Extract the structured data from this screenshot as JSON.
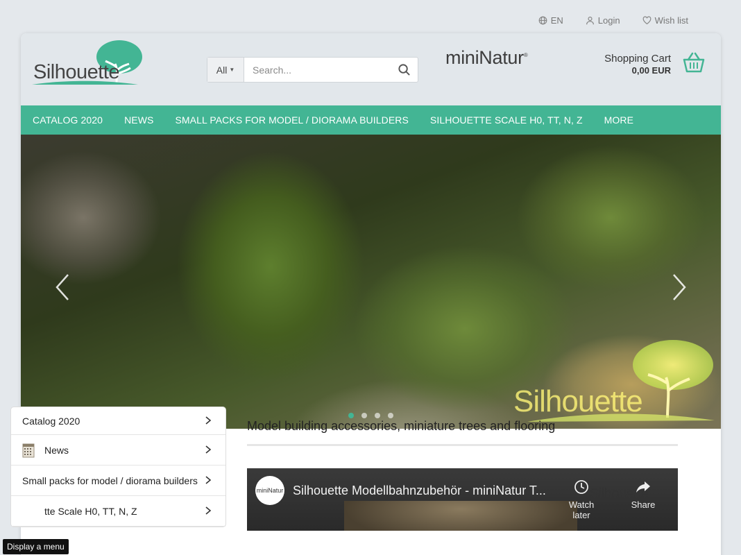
{
  "topbar": {
    "language": "EN",
    "login": "Login",
    "wishlist": "Wish list"
  },
  "header": {
    "logo_text": "Silhouette",
    "search": {
      "category": "All",
      "placeholder": "Search..."
    },
    "partner_logo_text": "miniNatur",
    "cart": {
      "label": "Shopping Cart",
      "amount": "0,00 EUR"
    }
  },
  "nav": {
    "items": [
      {
        "label": "CATALOG 2020"
      },
      {
        "label": "NEWS"
      },
      {
        "label": "SMALL PACKS FOR MODEL / DIORAMA BUILDERS"
      },
      {
        "label": "SILHOUETTE SCALE H0, TT, N, Z"
      },
      {
        "label": "MORE"
      }
    ]
  },
  "hero": {
    "brand_text": "Silhouette",
    "slides_count": 4,
    "active_slide": 1
  },
  "sidebar": {
    "items": [
      {
        "label": "Catalog 2020"
      },
      {
        "label": "News"
      },
      {
        "label": "Small packs for model / diorama builders"
      },
      {
        "label": "tte Scale H0, TT, N, Z"
      }
    ]
  },
  "main": {
    "title": "Model building accessories, miniature trees and flooring",
    "video": {
      "channel": "miniNatur",
      "title": "Silhouette Modellbahnzubehör - miniNatur T...",
      "watch_later": "Watch later",
      "share": "Share",
      "brand_text": "Silhouette"
    }
  },
  "menu_toggle": "Display a menu",
  "colors": {
    "accent": "#43b594",
    "header_bg": "#e2e7eb",
    "page_bg": "#e4e8ec"
  }
}
